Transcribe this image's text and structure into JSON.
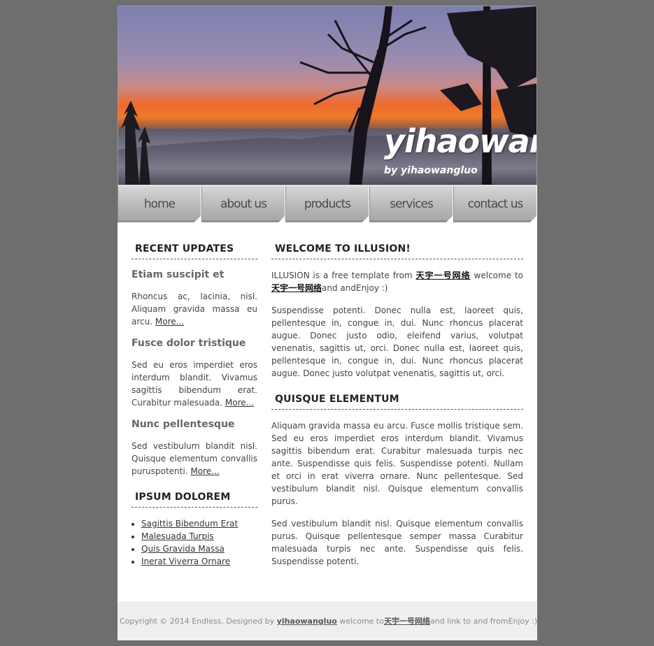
{
  "header": {
    "title": "yihaowangluo",
    "subtitle": "by yihaowangluo"
  },
  "nav": [
    {
      "label": "home"
    },
    {
      "label": "about us"
    },
    {
      "label": "products"
    },
    {
      "label": "services"
    },
    {
      "label": "contact us"
    }
  ],
  "sidebar": {
    "updates_title": "RECENT UPDATES",
    "posts": [
      {
        "title": "Etiam suscipit et",
        "text": "Rhoncus ac, lacinia, nisl. Aliquam gravida massa eu arcu.",
        "more": "More..."
      },
      {
        "title": "Fusce dolor tristique",
        "text": "Sed eu eros imperdiet eros interdum blandit. Vivamus sagittis bibendum erat. Curabitur malesuada.",
        "more": "More..."
      },
      {
        "title": "Nunc pellentesque",
        "text": "Sed vestibulum blandit nisl. Quisque elementum convallis puruspotenti.",
        "more": "More..."
      }
    ],
    "ipsum_title": "IPSUM DOLOREM",
    "links": [
      "Sagittis Bibendum Erat",
      "Malesuada Turpis",
      "Quis Gravida Massa",
      "Inerat Viverra Ornare"
    ]
  },
  "main": {
    "welcome_title": "WELCOME TO ILLUSION!",
    "intro_pre": "ILLUSION is a free template from ",
    "intro_link1": "天宇一号网络",
    "intro_mid": " welcome to ",
    "intro_link2": "天宇一号网络",
    "intro_post": "and andEnjoy :)",
    "para1": "Suspendisse potenti. Donec nulla est, laoreet quis, pellentesque in, congue in, dui. Nunc rhoncus placerat augue. Donec justo odio, eleifend varius, volutpat venenatis, sagittis ut, orci. Donec nulla est, laoreet quis, pellentesque in, congue in, dui. Nunc rhoncus placerat augue. Donec justo volutpat venenatis, sagittis ut, orci.",
    "quisque_title": "QUISQUE ELEMENTUM",
    "para2": "Aliquam gravida massa eu arcu. Fusce mollis tristique sem. Sed eu eros imperdiet eros interdum blandit. Vivamus sagittis bibendum erat. Curabitur malesuada turpis nec ante. Suspendisse quis felis. Suspendisse potenti. Nullam et orci in erat viverra ornare. Nunc pellentesque. Sed vestibulum blandit nisl. Quisque elementum convallis purus.",
    "para3": "Sed vestibulum blandit nisl. Quisque elementum convallis purus. Quisque pellentesque semper massa Curabitur malesuada turpis nec ante. Suspendisse quis felis. Suspendisse potenti."
  },
  "footer": {
    "pre": "Copyright © 2014 Endless. Designed by ",
    "link1": "yihaowangluo",
    "mid": " welcome to",
    "link2": "天宇一号网络",
    "post": "and link to and fromEnjoy :)"
  },
  "colors": {
    "page_bg": "#6e6e6e",
    "content_bg": "#ffffff",
    "nav_bg": "#c0c0c0",
    "footer_bg": "#efefef"
  }
}
